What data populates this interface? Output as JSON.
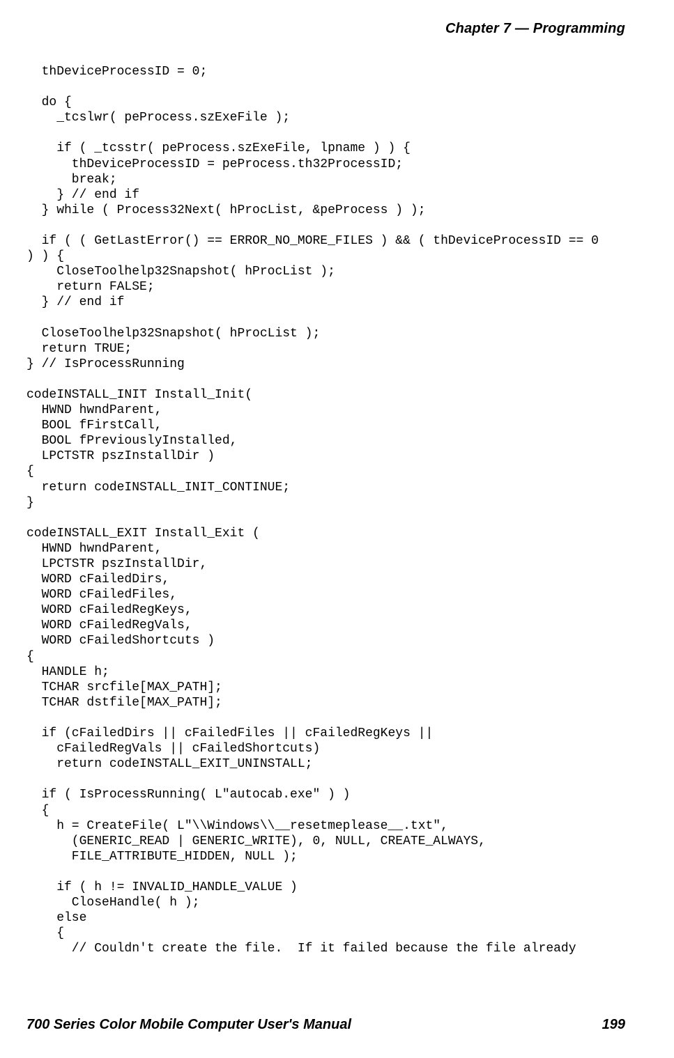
{
  "header": {
    "right": "Chapter 7 — Programming"
  },
  "footer": {
    "left": "700 Series Color Mobile Computer User's Manual",
    "right": "199"
  },
  "code": {
    "l1": "  thDeviceProcessID = 0;",
    "l2": "",
    "l3": "  do {",
    "l4": "    _tcslwr( peProcess.szExeFile );",
    "l5": "",
    "l6": "    if ( _tcsstr( peProcess.szExeFile, lpname ) ) {",
    "l7": "      thDeviceProcessID = peProcess.th32ProcessID;",
    "l8": "      break;",
    "l9": "    } // end if",
    "l10": "  } while ( Process32Next( hProcList, &peProcess ) );",
    "l11": "",
    "l12": "  if ( ( GetLastError() == ERROR_NO_MORE_FILES ) && ( thDeviceProcessID == 0",
    "l13": ") ) {",
    "l14": "    CloseToolhelp32Snapshot( hProcList );",
    "l15": "    return FALSE;",
    "l16": "  } // end if",
    "l17": "",
    "l18": "  CloseToolhelp32Snapshot( hProcList );",
    "l19": "  return TRUE;",
    "l20": "} // IsProcessRunning",
    "l21": "",
    "l22": "codeINSTALL_INIT Install_Init(",
    "l23": "  HWND hwndParent,",
    "l24": "  BOOL fFirstCall,",
    "l25": "  BOOL fPreviouslyInstalled,",
    "l26": "  LPCTSTR pszInstallDir )",
    "l27": "{",
    "l28": "  return codeINSTALL_INIT_CONTINUE;",
    "l29": "}",
    "l30": "",
    "l31": "codeINSTALL_EXIT Install_Exit (",
    "l32": "  HWND hwndParent,",
    "l33": "  LPCTSTR pszInstallDir,",
    "l34": "  WORD cFailedDirs,",
    "l35": "  WORD cFailedFiles,",
    "l36": "  WORD cFailedRegKeys,",
    "l37": "  WORD cFailedRegVals,",
    "l38": "  WORD cFailedShortcuts )",
    "l39": "{",
    "l40": "  HANDLE h;",
    "l41": "  TCHAR srcfile[MAX_PATH];",
    "l42": "  TCHAR dstfile[MAX_PATH];",
    "l43": "",
    "l44": "  if (cFailedDirs || cFailedFiles || cFailedRegKeys ||",
    "l45": "    cFailedRegVals || cFailedShortcuts)",
    "l46": "    return codeINSTALL_EXIT_UNINSTALL;",
    "l47": "",
    "l48": "  if ( IsProcessRunning( L\"autocab.exe\" ) )",
    "l49": "  {",
    "l50": "    h = CreateFile( L\"\\\\Windows\\\\__resetmeplease__.txt\",",
    "l51": "      (GENERIC_READ | GENERIC_WRITE), 0, NULL, CREATE_ALWAYS,",
    "l52": "      FILE_ATTRIBUTE_HIDDEN, NULL );",
    "l53": "",
    "l54": "    if ( h != INVALID_HANDLE_VALUE )",
    "l55": "      CloseHandle( h );",
    "l56": "    else",
    "l57": "    {",
    "l58": "      // Couldn't create the file.  If it failed because the file already"
  }
}
